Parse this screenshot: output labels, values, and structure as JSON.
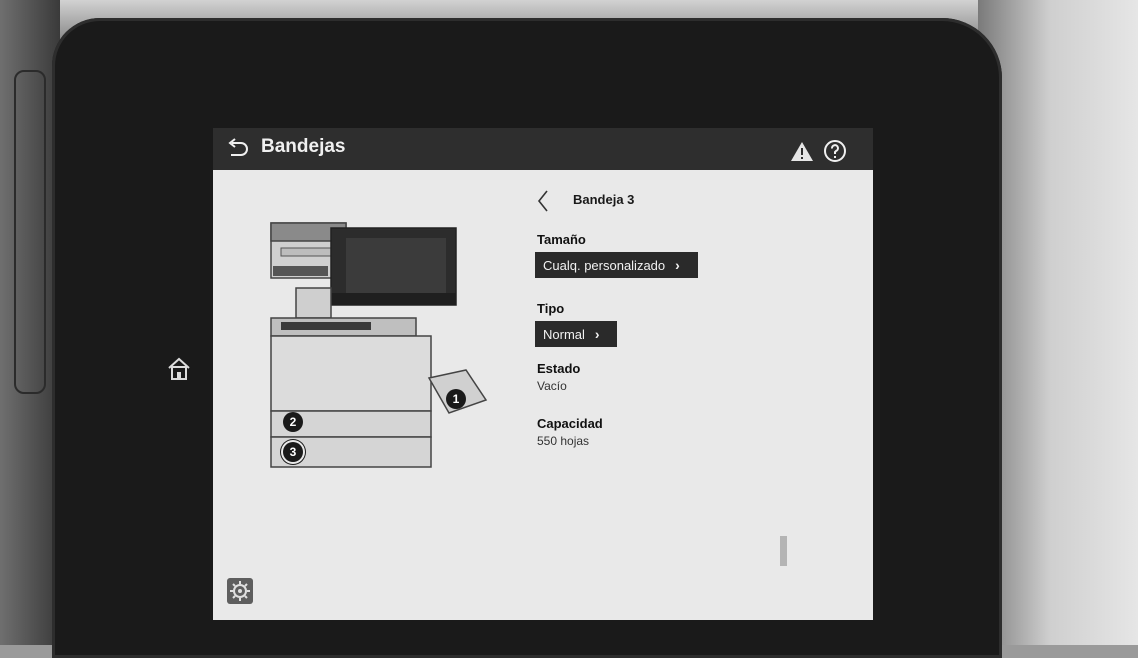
{
  "header": {
    "title": "Bandejas"
  },
  "icons": {
    "back": "back-arrow-icon",
    "warning": "warning-icon",
    "help": "help-icon",
    "home": "home-icon",
    "settings": "gear-icon",
    "prev": "chevron-left-icon",
    "next": "chevron-right-icon"
  },
  "tray": {
    "name": "Bandeja 3",
    "size_label": "Tamaño",
    "size_value": "Cualq. personalizado",
    "type_label": "Tipo",
    "type_value": "Normal",
    "status_label": "Estado",
    "status_value": "Vacío",
    "capacity_label": "Capacidad",
    "capacity_value": "550 hojas"
  },
  "printer": {
    "tray_badges": [
      "1",
      "2",
      "3"
    ]
  },
  "colors": {
    "appbar": "#2e2e2e",
    "screen_bg": "#e9e9e9",
    "pill_bg": "#2a2a2a"
  }
}
